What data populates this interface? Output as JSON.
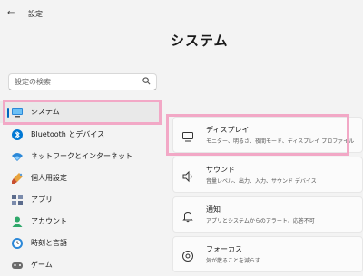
{
  "window": {
    "app_title": "設定",
    "back_glyph": "←"
  },
  "page_title": "システム",
  "search": {
    "placeholder": "設定の検索"
  },
  "sidebar": {
    "items": [
      {
        "label": "システム",
        "icon": "monitor-icon",
        "selected": true
      },
      {
        "label": "Bluetooth とデバイス",
        "icon": "bluetooth-icon"
      },
      {
        "label": "ネットワークとインターネット",
        "icon": "wifi-icon"
      },
      {
        "label": "個人用設定",
        "icon": "paint-brush-icon"
      },
      {
        "label": "アプリ",
        "icon": "apps-icon"
      },
      {
        "label": "アカウント",
        "icon": "person-icon"
      },
      {
        "label": "時刻と言語",
        "icon": "globe-clock-icon"
      },
      {
        "label": "ゲーム",
        "icon": "gamepad-icon"
      }
    ]
  },
  "cards": [
    {
      "title": "ディスプレイ",
      "desc": "モニター、明るさ、夜間モード、ディスプレイ プロファイル",
      "icon": "display-icon"
    },
    {
      "title": "サウンド",
      "desc": "音量レベル、出力、入力、サウンド デバイス",
      "icon": "speaker-icon"
    },
    {
      "title": "通知",
      "desc": "アプリとシステムからのアラート、応答不可",
      "icon": "bell-icon"
    },
    {
      "title": "フォーカス",
      "desc": "気が散ることを減らす",
      "icon": "focus-icon"
    }
  ],
  "colors": {
    "accent": "#0067c0",
    "highlight": "#f2a8c6",
    "background": "#f3f3f3"
  }
}
